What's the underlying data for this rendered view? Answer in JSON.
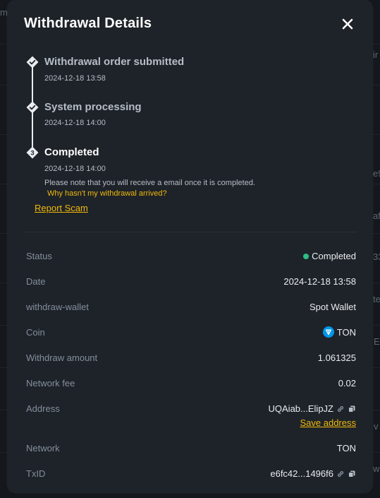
{
  "modal": {
    "title": "Withdrawal Details"
  },
  "steps": [
    {
      "number": "",
      "title": "Withdrawal order submitted",
      "time": "2024-12-18 13:58"
    },
    {
      "number": "",
      "title": "System processing",
      "time": "2024-12-18 14:00"
    },
    {
      "number": "3",
      "title": "Completed",
      "time": "2024-12-18 14:00"
    }
  ],
  "note": "Please note that you will receive a email once it is completed.",
  "why_link": "Why hasn't my withdrawal arrived?",
  "report_link": "Report Scam",
  "details": {
    "status": {
      "label": "Status",
      "value": "Completed"
    },
    "date": {
      "label": "Date",
      "value": "2024-12-18 13:58"
    },
    "wallet": {
      "label": "withdraw-wallet",
      "value": "Spot Wallet"
    },
    "coin": {
      "label": "Coin",
      "value": "TON"
    },
    "amount": {
      "label": "Withdraw amount",
      "value": "1.061325"
    },
    "fee": {
      "label": "Network fee",
      "value": "0.02"
    },
    "address": {
      "label": "Address",
      "value": "UQAiab...ElipJZ",
      "save_label": "Save address"
    },
    "network": {
      "label": "Network",
      "value": "TON"
    },
    "txid": {
      "label": "TxID",
      "value": "e6fc42...1496f6"
    }
  },
  "background_fragments": [
    "m",
    "e9",
    "afo",
    "33",
    "te",
    "E",
    "v",
    "w",
    "ir"
  ],
  "colors": {
    "accent": "#f0b90b",
    "success": "#2ebd85",
    "ton": "#0098ea",
    "modal_bg": "#1e2329"
  }
}
